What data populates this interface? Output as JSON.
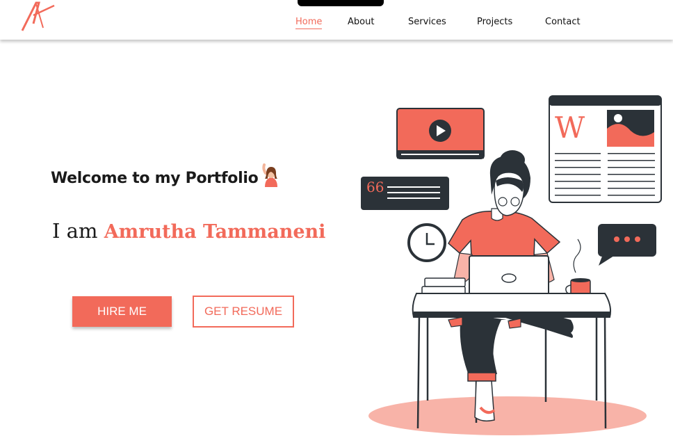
{
  "nav": {
    "items": [
      {
        "label": "Home",
        "active": true
      },
      {
        "label": "About",
        "active": false
      },
      {
        "label": "Services",
        "active": false
      },
      {
        "label": "Projects",
        "active": false
      },
      {
        "label": "Contact",
        "active": false
      }
    ]
  },
  "hero": {
    "welcome": "Welcome to my Portfolio",
    "intro_prefix": "I am",
    "name": "Amrutha Tammaneni",
    "hire_label": "HIRE ME",
    "resume_label": "GET RESUME"
  },
  "illustration": {
    "wiki_letter": "W"
  },
  "colors": {
    "accent": "#f26a5a",
    "dark": "#2b3238",
    "peach": "#f8b3a8"
  }
}
